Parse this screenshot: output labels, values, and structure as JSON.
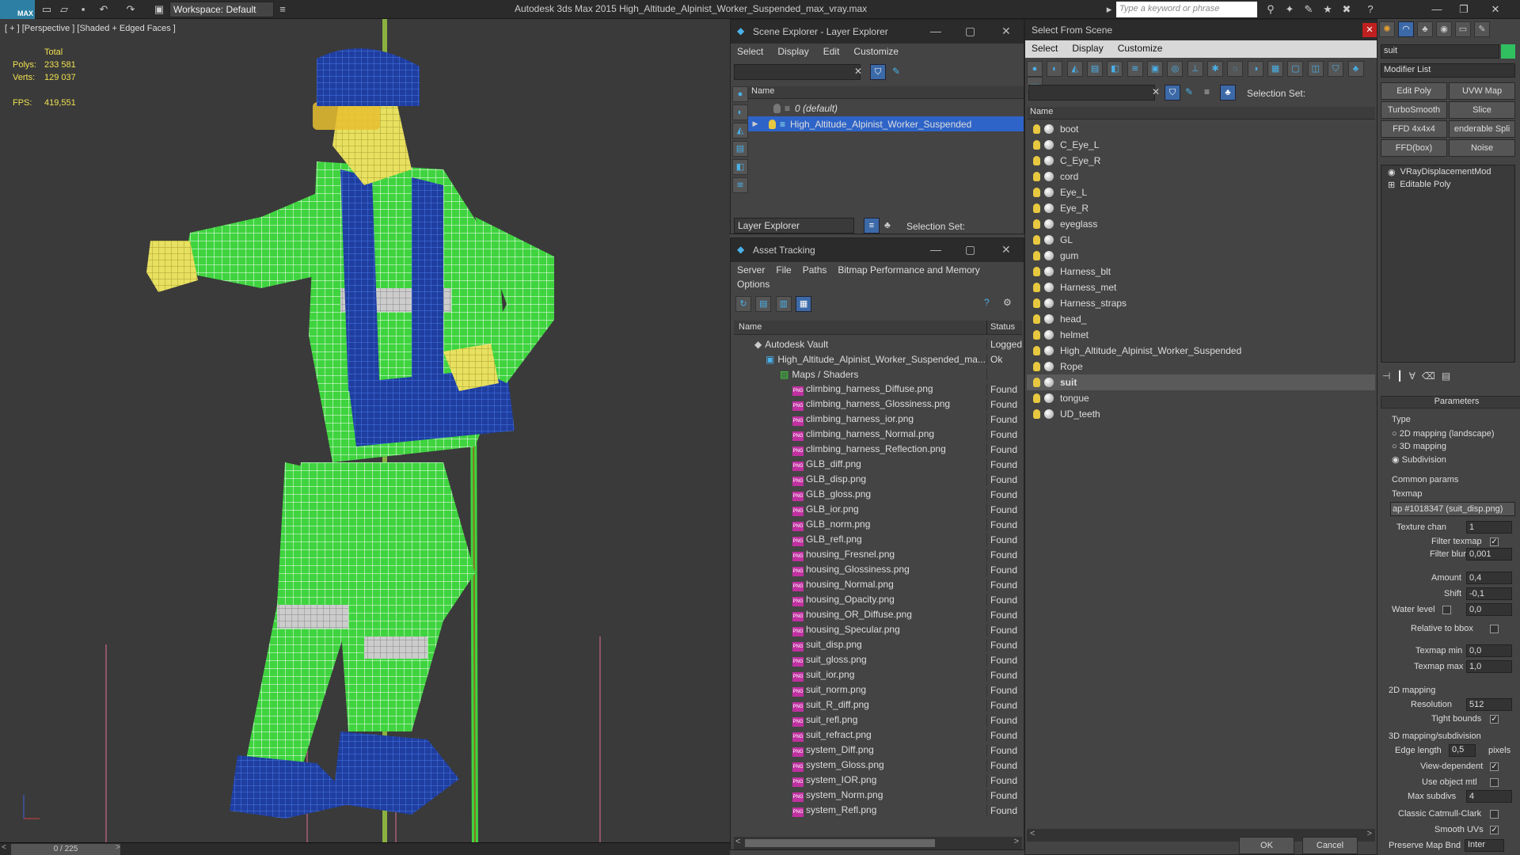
{
  "app": {
    "logo": "MAX",
    "workspace": "Workspace: Default",
    "title": "Autodesk 3ds Max  2015    High_Altitude_Alpinist_Worker_Suspended_max_vray.max",
    "search_placeholder": "Type a keyword or phrase"
  },
  "viewport": {
    "label": "[ + ] [Perspective ] [Shaded + Edged Faces ]",
    "stats": {
      "total": "Total",
      "polys_label": "Polys:",
      "polys": "233 581",
      "verts_label": "Verts:",
      "verts": "129 037",
      "fps_label": "FPS:",
      "fps": "419,551"
    },
    "frame": "0 / 225"
  },
  "scene_explorer": {
    "title": "Scene Explorer - Layer Explorer",
    "menu": [
      "Select",
      "Display",
      "Edit",
      "Customize"
    ],
    "col_name": "Name",
    "rows": [
      "0 (default)",
      "High_Altitude_Alpinist_Worker_Suspended"
    ],
    "footer_left": "Layer Explorer",
    "footer_right": "Selection Set:"
  },
  "asset_tracking": {
    "title": "Asset Tracking",
    "menu": [
      "Server",
      "File",
      "Paths",
      "Bitmap Performance and Memory",
      "Options"
    ],
    "col_name": "Name",
    "col_status": "Status",
    "vault": "Autodesk Vault",
    "vault_status": "Logged",
    "file": "High_Altitude_Alpinist_Worker_Suspended_ma...",
    "file_status": "Ok",
    "maps": "Maps / Shaders",
    "files": [
      "climbing_harness_Diffuse.png",
      "climbing_harness_Glossiness.png",
      "climbing_harness_ior.png",
      "climbing_harness_Normal.png",
      "climbing_harness_Reflection.png",
      "GLB_diff.png",
      "GLB_disp.png",
      "GLB_gloss.png",
      "GLB_ior.png",
      "GLB_norm.png",
      "GLB_refl.png",
      "housing_Fresnel.png",
      "housing_Glossiness.png",
      "housing_Normal.png",
      "housing_Opacity.png",
      "housing_OR_Diffuse.png",
      "housing_Specular.png",
      "suit_disp.png",
      "suit_gloss.png",
      "suit_ior.png",
      "suit_norm.png",
      "suit_R_diff.png",
      "suit_refl.png",
      "suit_refract.png",
      "system_Diff.png",
      "system_Gloss.png",
      "system_IOR.png",
      "system_Norm.png",
      "system_Refl.png"
    ],
    "found": "Found",
    "png_icon": "PNG"
  },
  "select_from_scene": {
    "title": "Select From Scene",
    "menu": [
      "Select",
      "Display",
      "Customize"
    ],
    "selection_set": "Selection Set:",
    "col_name": "Name",
    "objects": [
      "boot",
      "C_Eye_L",
      "C_Eye_R",
      "cord",
      "Eye_L",
      "Eye_R",
      "eyeglass",
      "GL",
      "gum",
      "Harness_blt",
      "Harness_met",
      "Harness_straps",
      "head_",
      "helmet",
      "High_Altitude_Alpinist_Worker_Suspended",
      "Rope",
      "suit",
      "tongue",
      "UD_teeth"
    ],
    "selected": "suit",
    "ok": "OK",
    "cancel": "Cancel"
  },
  "command_panel": {
    "object_name": "suit",
    "modifier_list": "Modifier List",
    "buttons": [
      "Edit Poly",
      "UVW Map",
      "TurboSmooth",
      "Slice",
      "FFD 4x4x4",
      "enderable Spli",
      "FFD(box)",
      "Noise"
    ],
    "stack": [
      "VRayDisplacementMod",
      "Editable Poly"
    ],
    "parameters": "Parameters",
    "type": "Type",
    "types": [
      "2D mapping (landscape)",
      "3D mapping",
      "Subdivision"
    ],
    "common": "Common params",
    "texmap": "Texmap",
    "texmap_value": "ap #1018347 (suit_disp.png)",
    "texture_chan": "Texture chan",
    "texture_chan_v": "1",
    "filter_texmap": "Filter texmap",
    "filter_blur": "Filter blur",
    "filter_blur_v": "0,001",
    "amount": "Amount",
    "amount_v": "0,4",
    "shift": "Shift",
    "shift_v": "-0,1",
    "water_level": "Water level",
    "water_level_v": "0,0",
    "relative": "Relative to bbox",
    "texmap_min": "Texmap min",
    "texmap_min_v": "0,0",
    "texmap_max": "Texmap max",
    "texmap_max_v": "1,0",
    "mapping2d": "2D mapping",
    "resolution": "Resolution",
    "resolution_v": "512",
    "tight": "Tight bounds",
    "mapping3d": "3D mapping/subdivision",
    "edge_length": "Edge length",
    "edge_length_v": "0,5",
    "pixels": "pixels",
    "view_dep": "View-dependent",
    "use_obj": "Use object mtl",
    "max_subdivs": "Max subdivs",
    "max_subdivs_v": "4",
    "catmull": "Classic Catmull-Clark",
    "smooth_uvs": "Smooth UVs",
    "preserve": "Preserve Map Bnd",
    "preserve_v": "Inter"
  },
  "colors": {
    "wire_green": "#3fd43f",
    "wire_blue": "#2c58c8",
    "selection_blue": "#2e64c8"
  }
}
